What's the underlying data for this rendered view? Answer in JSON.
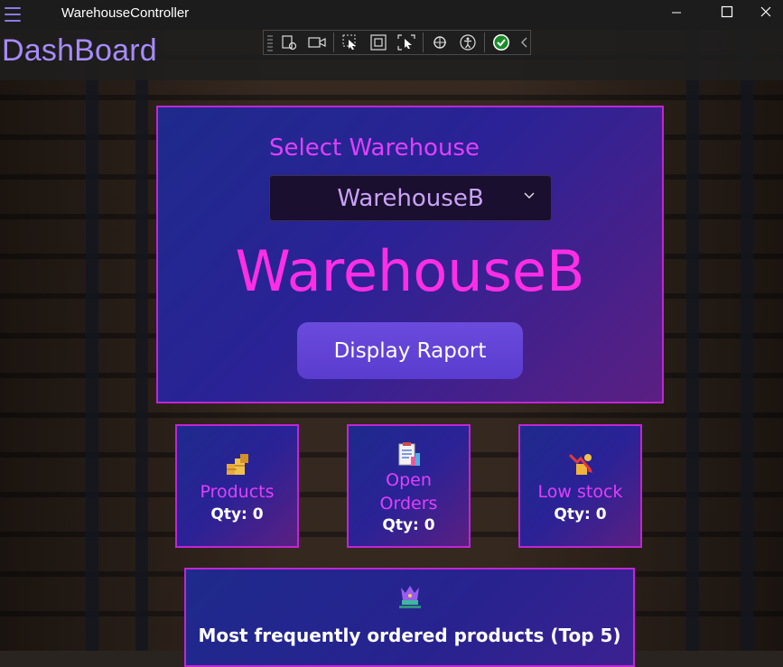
{
  "window": {
    "title": "WarehouseController"
  },
  "page": {
    "title": "DashBoard"
  },
  "selector": {
    "label": "Select Warehouse",
    "selected": "WarehouseB"
  },
  "main": {
    "current_warehouse": "WarehouseB",
    "display_button": "Display Raport"
  },
  "stats": {
    "products": {
      "label": "Products",
      "qty": "Qty: 0"
    },
    "open_orders": {
      "label": "Open Orders",
      "label_line1": "Open",
      "label_line2": "Orders",
      "qty": "Qty: 0"
    },
    "low_stock": {
      "label": "Low stock",
      "qty": "Qty: 0"
    }
  },
  "top5": {
    "title": "Most frequently ordered products (Top 5)"
  },
  "colors": {
    "accent_pink": "#e040fb",
    "accent_magenta": "#ff2ee6",
    "title_purple": "#a78bfa",
    "card_border": "#c026d3",
    "button": "#5a3ccf"
  },
  "icons": {
    "menu": "hamburger-icon",
    "products": "boxes-icon",
    "open_orders": "clipboard-icon",
    "low_stock": "declining-chart-icon",
    "top5": "trophy-icon"
  }
}
